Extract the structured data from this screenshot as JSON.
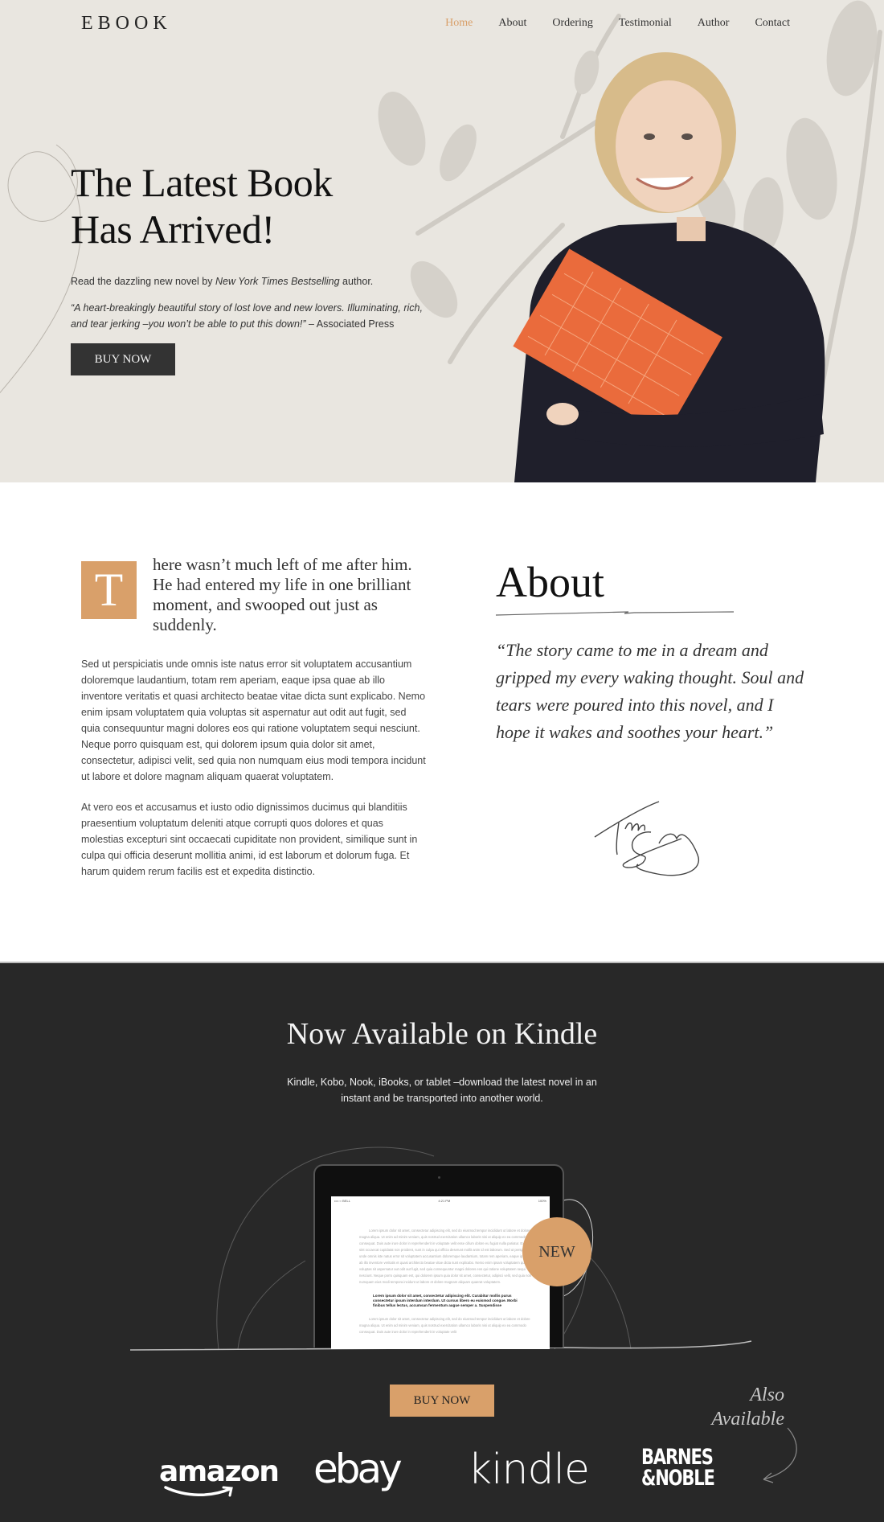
{
  "nav": {
    "logo": "EBOOK",
    "links": [
      {
        "label": "Home",
        "active": true
      },
      {
        "label": "About"
      },
      {
        "label": "Ordering"
      },
      {
        "label": "Testimonial"
      },
      {
        "label": "Author"
      },
      {
        "label": "Contact"
      }
    ]
  },
  "hero": {
    "title_line1": "The Latest Book",
    "title_line2": "Has Arrived!",
    "lead_prefix": "Read the dazzling new novel by ",
    "lead_em": "New York Times Bestselling",
    "lead_suffix": " author.",
    "quote_em": "“A heart-breakingly beautiful story of lost love and new lovers. Illuminating, rich, and tear jerking –you won’t be able to put this down!”",
    "quote_source": " – Associated Press",
    "buy_button": "BUY NOW"
  },
  "about": {
    "dropcap": "T",
    "lead": "here wasn’t much left of me after him. He had entered my life in one brilliant moment, and swooped out just as suddenly.",
    "paragraphs": [
      "Sed ut perspiciatis unde omnis iste natus error sit voluptatem accusantium doloremque laudantium, totam rem aperiam, eaque ipsa quae ab illo inventore veritatis et quasi architecto beatae vitae dicta sunt explicabo. Nemo enim ipsam voluptatem quia voluptas sit aspernatur aut odit aut fugit, sed quia consequuntur magni dolores eos qui ratione voluptatem sequi nesciunt. Neque porro quisquam est, qui dolorem ipsum quia dolor sit amet, consectetur, adipisci velit, sed quia non numquam eius modi tempora incidunt ut labore et dolore magnam aliquam quaerat voluptatem.",
      "At vero eos et accusamus et iusto odio dignissimos ducimus qui blanditiis praesentium voluptatum deleniti atque corrupti quos dolores et quas molestias excepturi sint occaecati cupiditate non provident, similique sunt in culpa qui officia deserunt mollitia animi, id est laborum et dolorum fuga. Et harum quidem rerum facilis est et expedita distinctio."
    ],
    "title": "About",
    "quote": "“The story came to me in a dream and gripped my every waking thought. Soul and tears were poured into this novel, and I hope it wakes and soothes your heart.”",
    "signature_alt": "Tara signature"
  },
  "kindle": {
    "title": "Now Available on Kindle",
    "subtitle": "Kindle, Kobo, Nook, iBooks, or tablet –download the latest novel in an instant and be transported into another world.",
    "tablet": {
      "carrier": "•••○○ BELL",
      "time": "4:21 PM",
      "battery": "100%",
      "para1": "Lorem ipsum dolor sit amet, consectetur adipiscing elit, sed do eiusmod tempor incididunt ut labore et dolore magna aliqua. Ut enim ad minim veniam, quis nostrud exercitation ullamco laboris nisi ut aliquip ex ea commodo consequat. Duis aute irure dolor in reprehenderit in voluptate velit esse cillum dolore eu fugiat nulla pariatur. Excepteur sint occaecat cupidatat non proident, sunt in culpa qui officia deserunt mollit anim id est laborum. Sed ut perspiciatis unde omnis iste natus error sit voluptatem accusantium doloremque laudantium, totam rem aperiam, eaque ipsa quae ab illo inventore veritatis et quasi architecto beatae vitae dicta sunt explicabo. Nemo enim ipsam voluptatem quia voluptas sit aspernatur aut odit aut fugit, sed quia consequuntur magni dolores eos qui ratione voluptatem sequi nesciunt. Neque porro quisquam est, qui dolorem ipsum quia dolor sit amet, consectetur, adipisci velit, sed quia non numquam eius modi tempora incidunt ut labore et dolore magnam aliquam quaerat voluptatem.",
      "bold": "Lorem ipsum dolor sit amet, consectetur adipiscing elit. Curabitur mollis purus consectetur ipsum interdum interdum. Ut cursus libero eu euismod congue. Morbi finibus tellus lectus, accumsan fermentum augue semper a. Suspendisse",
      "para2": "Lorem ipsum dolor sit amet, consectetur adipiscing elit, sed do eiusmod tempor incididunt ut labore et dolore magna aliqua. Ut enim ad minim veniam, quis nostrud exercitation ullamco laboris nisi ut aliquip ex ea commodo consequat. Duis aute irure dolor in reprehenderit in voluptate velit"
    },
    "badge": "NEW",
    "buy_button": "BUY NOW",
    "also_available": "Also Available",
    "stores": [
      "amazon",
      "ebay",
      "kindle",
      "BARNES & NOBLE"
    ],
    "bn_line1": "BARNES",
    "bn_line2": "&NOBLE"
  },
  "colors": {
    "accent": "#d9a06a",
    "hero_bg": "#e9e6e0",
    "dark_bg": "#282828",
    "button_dark": "#333333"
  }
}
